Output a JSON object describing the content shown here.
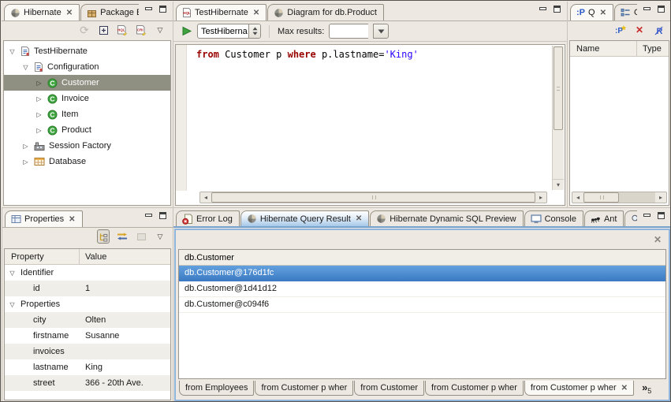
{
  "colors": {
    "background": "#EDE9E2",
    "keyword": "#990000",
    "string_literal": "#2A00FF",
    "tree_selection": "#8F8F82",
    "row_selection_blue": "#4688D0",
    "focus_tab_blue": "#A6C8E8"
  },
  "hibernate_view": {
    "tabs": [
      {
        "label": "Hibernate",
        "icon": "hibernate-icon",
        "active": true,
        "closable": true
      },
      {
        "label": "Package E",
        "icon": "package-icon"
      }
    ],
    "toolbar": [
      "refresh-icon",
      "expand-all-icon",
      "hql-editor-icon",
      "criteria-editor-icon",
      "view-menu-icon"
    ],
    "tree": [
      {
        "label": "TestHibernate",
        "level": 0,
        "expanded": true,
        "icon": "config-file-icon"
      },
      {
        "label": "Configuration",
        "level": 1,
        "expanded": true,
        "icon": "config-file-icon"
      },
      {
        "label": "Customer",
        "level": 2,
        "expanded": false,
        "icon": "class-icon",
        "selected": true
      },
      {
        "label": "Invoice",
        "level": 2,
        "expanded": false,
        "icon": "class-icon"
      },
      {
        "label": "Item",
        "level": 2,
        "expanded": false,
        "icon": "class-icon"
      },
      {
        "label": "Product",
        "level": 2,
        "expanded": false,
        "icon": "class-icon"
      },
      {
        "label": "Session Factory",
        "level": 1,
        "expanded": false,
        "icon": "factory-icon"
      },
      {
        "label": "Database",
        "level": 1,
        "expanded": false,
        "icon": "database-icon"
      }
    ]
  },
  "editor": {
    "tabs": [
      {
        "label": "TestHibernate",
        "icon": "hql-file-icon",
        "active": true,
        "closable": true
      },
      {
        "label": "Diagram for db.Product",
        "icon": "hibernate-icon"
      }
    ],
    "console_combo": {
      "value": "TestHiberna"
    },
    "max_results": {
      "label": "Max results:",
      "value": ""
    },
    "query_segments": [
      {
        "text": "from",
        "style": "keyword"
      },
      {
        "text": " Customer p ",
        "style": "plain"
      },
      {
        "text": "where",
        "style": "keyword"
      },
      {
        "text": " p.lastname=",
        "style": "plain"
      },
      {
        "text": "'King'",
        "style": "string"
      }
    ]
  },
  "params_view": {
    "tabs": [
      {
        "label": "Q",
        "icon": "query-parameters-icon",
        "active": true,
        "closable": true
      },
      {
        "label": "O",
        "icon": "outline-icon"
      }
    ],
    "toolbar": [
      "new-parameter-icon",
      "remove-parameter-icon",
      "clear-parameters-icon"
    ],
    "columns": [
      "Name",
      "Type"
    ]
  },
  "properties_view": {
    "tabs": [
      {
        "label": "Properties",
        "icon": "properties-icon",
        "active": true,
        "closable": true
      }
    ],
    "toolbar": [
      "tree-mode-icon",
      "sort-icon",
      "restore-default-icon",
      "view-menu-icon"
    ],
    "columns": [
      "Property",
      "Value"
    ],
    "rows": [
      {
        "property": "Identifier",
        "value": "",
        "group": true
      },
      {
        "property": "id",
        "value": "1"
      },
      {
        "property": "Properties",
        "value": "",
        "group": true
      },
      {
        "property": "city",
        "value": "Olten"
      },
      {
        "property": "firstname",
        "value": "Susanne"
      },
      {
        "property": "invoices",
        "value": ""
      },
      {
        "property": "lastname",
        "value": "King"
      },
      {
        "property": "street",
        "value": "366 - 20th Ave."
      }
    ]
  },
  "results_view": {
    "tabs": [
      {
        "label": "Error Log",
        "icon": "error-log-icon"
      },
      {
        "label": "Hibernate Query Result",
        "icon": "hibernate-icon",
        "active": true,
        "closable": true
      },
      {
        "label": "Hibernate Dynamic SQL Preview",
        "icon": "hibernate-icon"
      },
      {
        "label": "Console",
        "icon": "console-icon"
      },
      {
        "label": "Ant",
        "icon": "ant-icon"
      },
      {
        "label": "Search",
        "icon": "search-icon"
      }
    ],
    "table": {
      "header": "db.Customer",
      "rows": [
        "db.Customer@176d1fc",
        "db.Customer@1d41d12",
        "db.Customer@c094f6"
      ],
      "selected_index": 0
    },
    "query_tabs": [
      {
        "label": "from Employees"
      },
      {
        "label": "from Customer p wher"
      },
      {
        "label": "from Customer"
      },
      {
        "label": "from Customer p wher"
      },
      {
        "label": "from Customer p wher",
        "active": true,
        "closable": true
      }
    ],
    "overflow": {
      "chevron": "»",
      "count": "5"
    }
  }
}
